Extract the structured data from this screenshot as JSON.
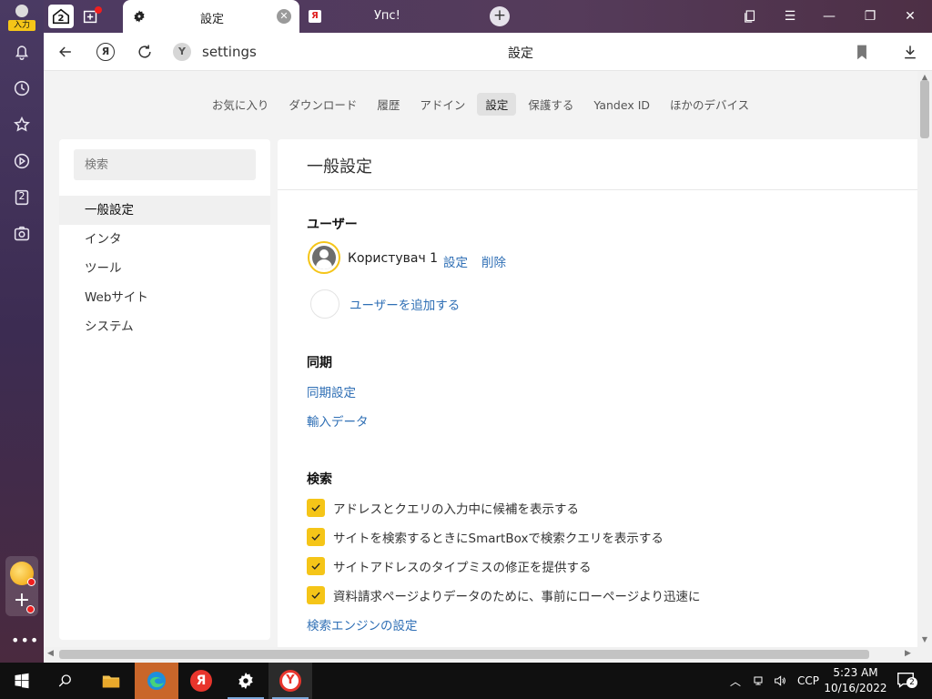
{
  "rail": {
    "profile_tag": "入力",
    "tab_count_badge": "2",
    "icons": [
      "bell-icon",
      "history-icon",
      "star-icon",
      "play-icon",
      "counter-icon",
      "screenshot-icon"
    ]
  },
  "tabstrip": {
    "home_badge": "2",
    "active_tab": {
      "label": "設定",
      "close": "✕"
    },
    "inactive_tab": {
      "label": "Упс!",
      "favicon": "Я"
    }
  },
  "addressbar": {
    "site_badge": "Y",
    "ya_letter": "Я",
    "url": "settings",
    "page_title": "設定"
  },
  "topnav": {
    "items": [
      "お気に入り",
      "ダウンロード",
      "履歴",
      "アドイン",
      "設定",
      "保護する",
      "Yandex ID",
      "ほかのデバイス"
    ],
    "active_index": 4
  },
  "sidebar": {
    "search_placeholder": "検索",
    "items": [
      "一般設定",
      "インタ",
      "ツール",
      "Webサイト",
      "システム"
    ],
    "active_index": 0
  },
  "main": {
    "title": "一般設定",
    "users": {
      "heading": "ユーザー",
      "user_name": "Користувач 1",
      "settings_link": "設定",
      "delete_link": "削除",
      "add_user_link": "ユーザーを追加する"
    },
    "sync": {
      "heading": "同期",
      "settings_link": "同期設定",
      "import_link": "輸入データ"
    },
    "search": {
      "heading": "検索",
      "options": [
        {
          "label": "アドレスとクエリの入力中に候補を表示する",
          "checked": true
        },
        {
          "label": "サイトを検索するときにSmartBoxで検索クエリを表示する",
          "checked": true
        },
        {
          "label": "サイトアドレスのタイプミスの修正を提供する",
          "checked": true
        },
        {
          "label": "資料請求ページよりデータのために、事前にローページより迅速に",
          "checked": true
        }
      ],
      "engine_link": "検索エンジンの設定"
    }
  },
  "taskbar": {
    "tray_lang": "CCP",
    "time": "5:23 AM",
    "date": "10/16/2022",
    "notif_count": "2"
  },
  "colors": {
    "accent_yellow": "#f5c518",
    "link_blue": "#2f6fb5"
  }
}
